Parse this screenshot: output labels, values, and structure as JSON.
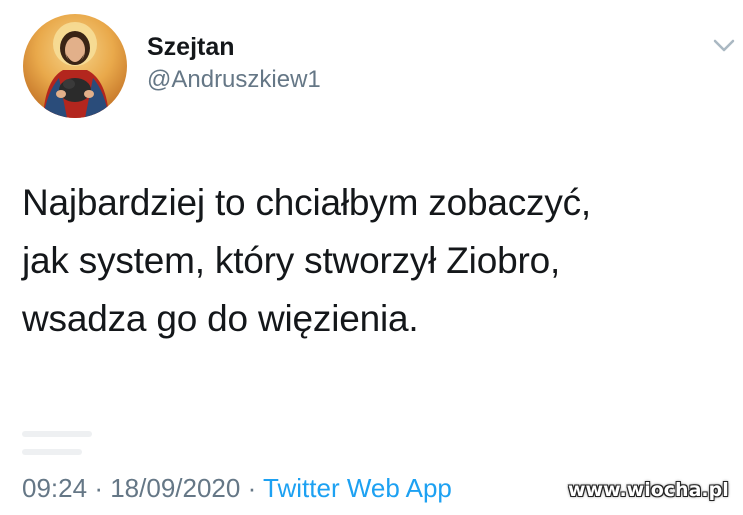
{
  "tweet": {
    "author": {
      "display_name": "Szejtan",
      "handle": "@Andruszkiew1",
      "avatar": "avatar-image"
    },
    "menu_icon": "chevron-down-icon",
    "text_lines": [
      "Najbardziej to chciałbym zobaczyć,",
      "jak system, który stworzył Ziobro,",
      "wsadza go do więzienia."
    ],
    "meta": {
      "time": "09:24",
      "separator": "·",
      "date": "18/09/2020",
      "source": "Twitter Web App"
    }
  },
  "watermark": "www.wiocha.pl",
  "colors": {
    "text": "#14171a",
    "secondary": "#657786",
    "link": "#1da1f2"
  }
}
